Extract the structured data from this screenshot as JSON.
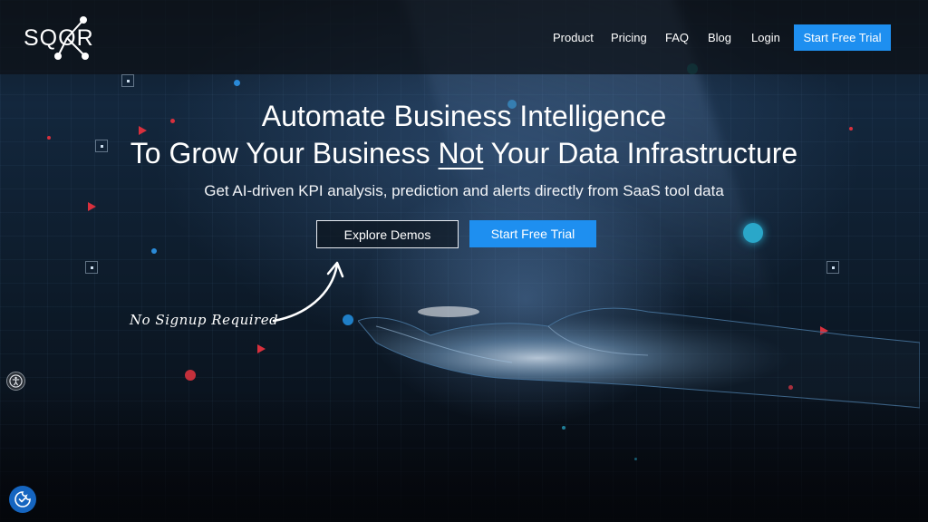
{
  "brand": {
    "logo_text": "SQOR"
  },
  "nav": {
    "items": [
      {
        "label": "Product"
      },
      {
        "label": "Pricing"
      },
      {
        "label": "FAQ"
      },
      {
        "label": "Blog"
      },
      {
        "label": "Login"
      }
    ],
    "cta_label": "Start Free Trial"
  },
  "hero": {
    "headline_line1": "Automate Business Intelligence",
    "headline_line2_part1": "To Grow Your Business ",
    "headline_line2_emphasis": "Not",
    "headline_line2_part2": " Your Data Infrastructure",
    "subheadline": "Get AI-driven KPI analysis, prediction and alerts directly from SaaS tool data",
    "secondary_button_label": "Explore Demos",
    "primary_button_label": "Start Free Trial",
    "handwritten_note": "No Signup Required"
  },
  "colors": {
    "accent_blue": "#1e8ff0",
    "background_dark": "#0a1018",
    "particle_red": "#d8303d",
    "particle_teal": "#2aa7c9"
  },
  "icons": {
    "accessibility": "accessibility-icon",
    "cookie_consent": "cookie-consent-icon"
  }
}
